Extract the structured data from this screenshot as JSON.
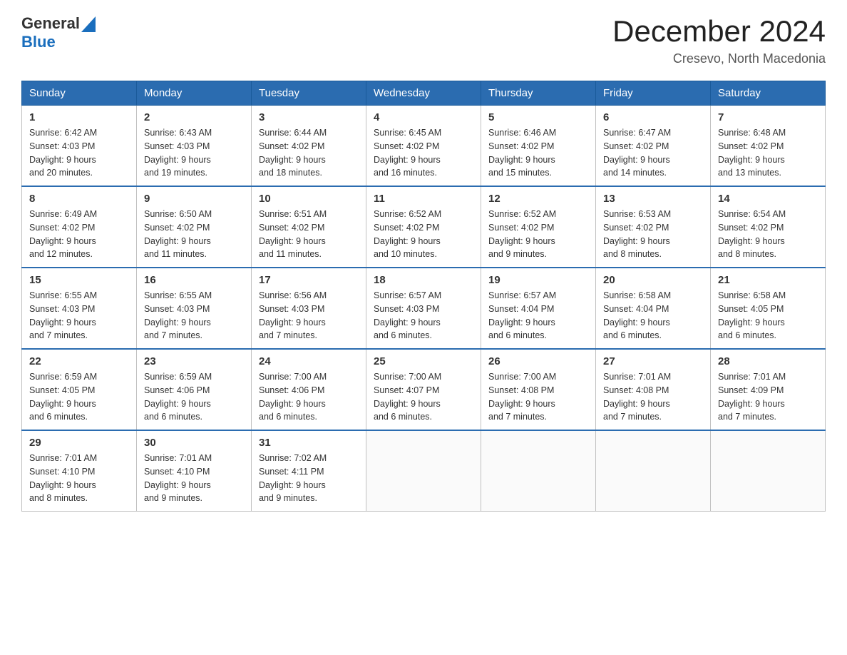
{
  "header": {
    "logo_general": "General",
    "logo_blue": "Blue",
    "title": "December 2024",
    "subtitle": "Cresevo, North Macedonia"
  },
  "days_of_week": [
    "Sunday",
    "Monday",
    "Tuesday",
    "Wednesday",
    "Thursday",
    "Friday",
    "Saturday"
  ],
  "weeks": [
    [
      {
        "day": "1",
        "sunrise": "6:42 AM",
        "sunset": "4:03 PM",
        "daylight": "9 hours and 20 minutes."
      },
      {
        "day": "2",
        "sunrise": "6:43 AM",
        "sunset": "4:03 PM",
        "daylight": "9 hours and 19 minutes."
      },
      {
        "day": "3",
        "sunrise": "6:44 AM",
        "sunset": "4:02 PM",
        "daylight": "9 hours and 18 minutes."
      },
      {
        "day": "4",
        "sunrise": "6:45 AM",
        "sunset": "4:02 PM",
        "daylight": "9 hours and 16 minutes."
      },
      {
        "day": "5",
        "sunrise": "6:46 AM",
        "sunset": "4:02 PM",
        "daylight": "9 hours and 15 minutes."
      },
      {
        "day": "6",
        "sunrise": "6:47 AM",
        "sunset": "4:02 PM",
        "daylight": "9 hours and 14 minutes."
      },
      {
        "day": "7",
        "sunrise": "6:48 AM",
        "sunset": "4:02 PM",
        "daylight": "9 hours and 13 minutes."
      }
    ],
    [
      {
        "day": "8",
        "sunrise": "6:49 AM",
        "sunset": "4:02 PM",
        "daylight": "9 hours and 12 minutes."
      },
      {
        "day": "9",
        "sunrise": "6:50 AM",
        "sunset": "4:02 PM",
        "daylight": "9 hours and 11 minutes."
      },
      {
        "day": "10",
        "sunrise": "6:51 AM",
        "sunset": "4:02 PM",
        "daylight": "9 hours and 11 minutes."
      },
      {
        "day": "11",
        "sunrise": "6:52 AM",
        "sunset": "4:02 PM",
        "daylight": "9 hours and 10 minutes."
      },
      {
        "day": "12",
        "sunrise": "6:52 AM",
        "sunset": "4:02 PM",
        "daylight": "9 hours and 9 minutes."
      },
      {
        "day": "13",
        "sunrise": "6:53 AM",
        "sunset": "4:02 PM",
        "daylight": "9 hours and 8 minutes."
      },
      {
        "day": "14",
        "sunrise": "6:54 AM",
        "sunset": "4:02 PM",
        "daylight": "9 hours and 8 minutes."
      }
    ],
    [
      {
        "day": "15",
        "sunrise": "6:55 AM",
        "sunset": "4:03 PM",
        "daylight": "9 hours and 7 minutes."
      },
      {
        "day": "16",
        "sunrise": "6:55 AM",
        "sunset": "4:03 PM",
        "daylight": "9 hours and 7 minutes."
      },
      {
        "day": "17",
        "sunrise": "6:56 AM",
        "sunset": "4:03 PM",
        "daylight": "9 hours and 7 minutes."
      },
      {
        "day": "18",
        "sunrise": "6:57 AM",
        "sunset": "4:03 PM",
        "daylight": "9 hours and 6 minutes."
      },
      {
        "day": "19",
        "sunrise": "6:57 AM",
        "sunset": "4:04 PM",
        "daylight": "9 hours and 6 minutes."
      },
      {
        "day": "20",
        "sunrise": "6:58 AM",
        "sunset": "4:04 PM",
        "daylight": "9 hours and 6 minutes."
      },
      {
        "day": "21",
        "sunrise": "6:58 AM",
        "sunset": "4:05 PM",
        "daylight": "9 hours and 6 minutes."
      }
    ],
    [
      {
        "day": "22",
        "sunrise": "6:59 AM",
        "sunset": "4:05 PM",
        "daylight": "9 hours and 6 minutes."
      },
      {
        "day": "23",
        "sunrise": "6:59 AM",
        "sunset": "4:06 PM",
        "daylight": "9 hours and 6 minutes."
      },
      {
        "day": "24",
        "sunrise": "7:00 AM",
        "sunset": "4:06 PM",
        "daylight": "9 hours and 6 minutes."
      },
      {
        "day": "25",
        "sunrise": "7:00 AM",
        "sunset": "4:07 PM",
        "daylight": "9 hours and 6 minutes."
      },
      {
        "day": "26",
        "sunrise": "7:00 AM",
        "sunset": "4:08 PM",
        "daylight": "9 hours and 7 minutes."
      },
      {
        "day": "27",
        "sunrise": "7:01 AM",
        "sunset": "4:08 PM",
        "daylight": "9 hours and 7 minutes."
      },
      {
        "day": "28",
        "sunrise": "7:01 AM",
        "sunset": "4:09 PM",
        "daylight": "9 hours and 7 minutes."
      }
    ],
    [
      {
        "day": "29",
        "sunrise": "7:01 AM",
        "sunset": "4:10 PM",
        "daylight": "9 hours and 8 minutes."
      },
      {
        "day": "30",
        "sunrise": "7:01 AM",
        "sunset": "4:10 PM",
        "daylight": "9 hours and 9 minutes."
      },
      {
        "day": "31",
        "sunrise": "7:02 AM",
        "sunset": "4:11 PM",
        "daylight": "9 hours and 9 minutes."
      },
      null,
      null,
      null,
      null
    ]
  ],
  "cell_labels": {
    "sunrise": "Sunrise:",
    "sunset": "Sunset:",
    "daylight": "Daylight:"
  }
}
